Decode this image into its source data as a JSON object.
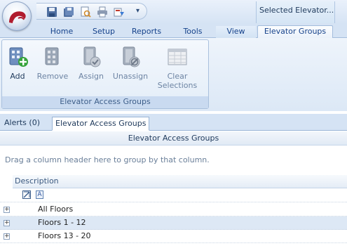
{
  "title_bar": {
    "context_title": "Selected  Elevator...",
    "quick_access_icons": [
      "save-icon",
      "save-all-icon",
      "print-preview-icon",
      "print-icon",
      "export-icon"
    ]
  },
  "ribbon_tabs": [
    {
      "label": "Home"
    },
    {
      "label": "Setup"
    },
    {
      "label": "Reports"
    },
    {
      "label": "Tools"
    },
    {
      "label": "View"
    },
    {
      "label": "Elevator Groups"
    }
  ],
  "ribbon": {
    "group_label": "Elevator Access Groups",
    "buttons": [
      {
        "label": "Add",
        "icon": "add-icon",
        "enabled": true
      },
      {
        "label": "Remove",
        "icon": "remove-icon",
        "enabled": false
      },
      {
        "label": "Assign",
        "icon": "assign-icon",
        "enabled": false
      },
      {
        "label": "Unassign",
        "icon": "unassign-icon",
        "enabled": false
      },
      {
        "label": "Clear\nSelections",
        "label_line1": "Clear",
        "label_line2": "Selections",
        "icon": "clear-selections-icon",
        "enabled": false
      }
    ]
  },
  "doc_tabs": [
    {
      "label": "Alerts (0)"
    },
    {
      "label": "Elevator Access Groups"
    }
  ],
  "grid": {
    "title": "Elevator Access Groups",
    "group_hint": "Drag a column header here to group by that column.",
    "column_header": "Description",
    "rows": [
      {
        "description": "All Floors"
      },
      {
        "description": "Floors 1 - 12"
      },
      {
        "description": "Floors 13 - 20"
      }
    ],
    "expand_glyph": "+"
  },
  "colors": {
    "ribbon_blue": "#d5e3f4",
    "text_blue": "#15428b",
    "alt_row": "#dde8f5"
  }
}
